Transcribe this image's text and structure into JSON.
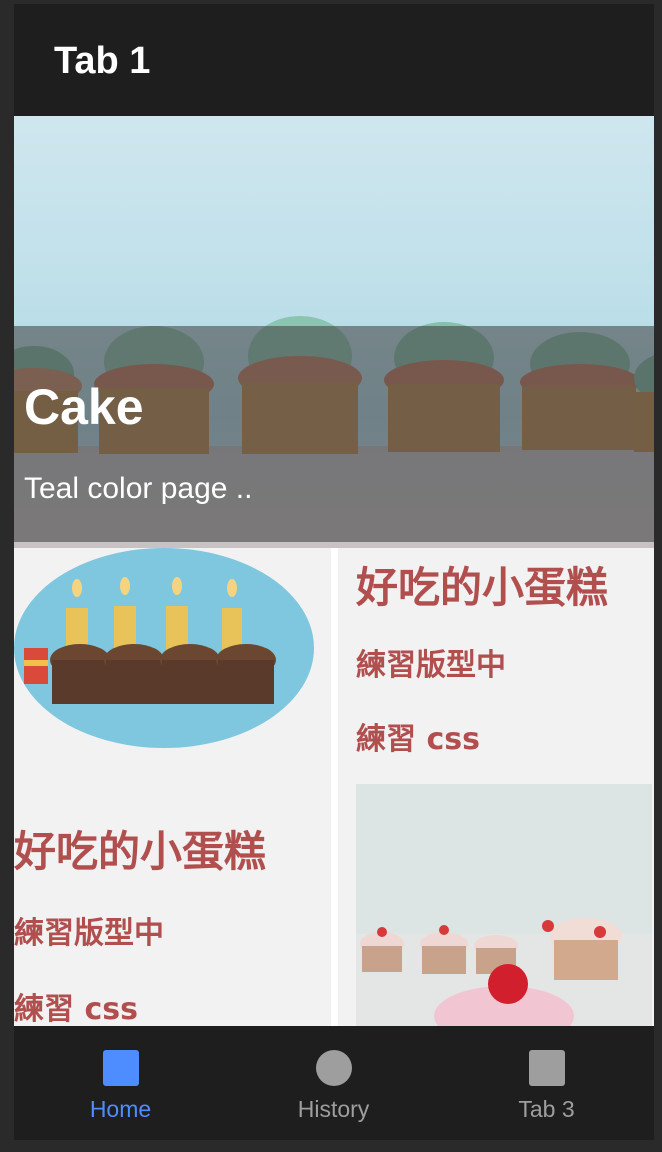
{
  "header": {
    "title": "Tab 1"
  },
  "hero": {
    "title": "Cake",
    "subtitle": "Teal color page .."
  },
  "card_left": {
    "title": "好吃的小蛋糕",
    "line1": "練習版型中",
    "line2": "練習 css"
  },
  "card_right": {
    "title": "好吃的小蛋糕",
    "line1": "練習版型中",
    "line2": "練習 css"
  },
  "tabs": [
    {
      "label": "Home",
      "icon": "square-icon",
      "active": true
    },
    {
      "label": "History",
      "icon": "circle-icon",
      "active": false
    },
    {
      "label": "Tab 3",
      "icon": "square-icon",
      "active": false
    }
  ],
  "colors": {
    "accent": "#4d8dff",
    "inactive": "#9e9e9e",
    "text_red": "#b14f4f",
    "bar_bg": "#1e1e1e"
  }
}
